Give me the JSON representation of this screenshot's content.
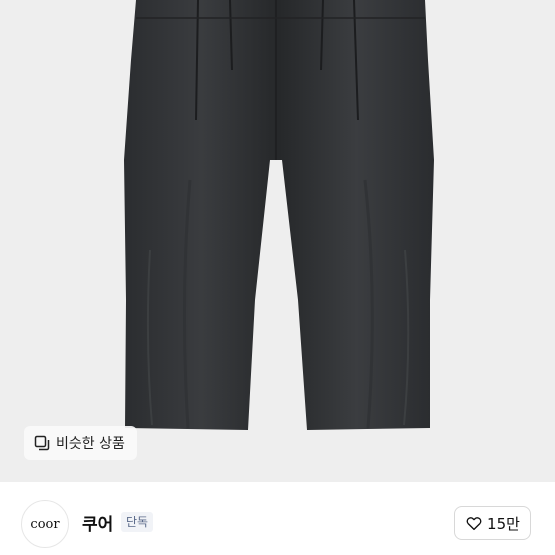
{
  "similar_button": {
    "label": "비슷한 상품",
    "icon": "copy-icon"
  },
  "shop": {
    "avatar_text": "coor",
    "name": "쿠어",
    "badge": "단독"
  },
  "like_button": {
    "icon": "heart-icon",
    "count": "15만"
  }
}
